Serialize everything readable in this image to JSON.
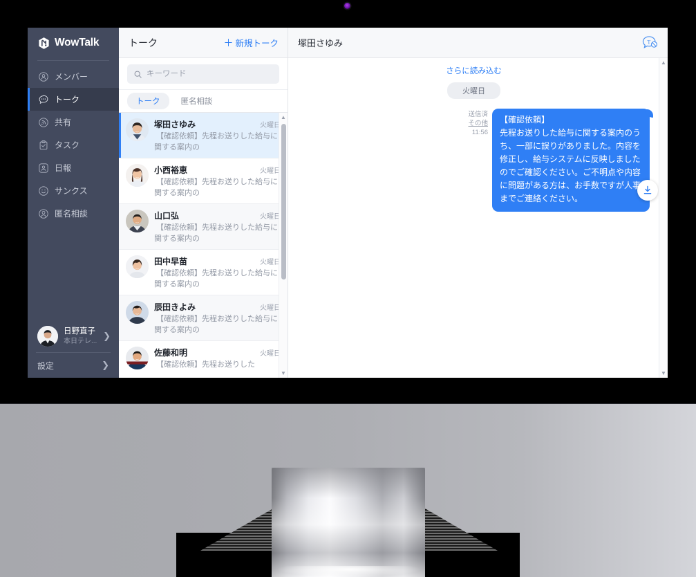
{
  "app": {
    "brand": "WowTalk",
    "logo_icon": "wowtalk-hex-logo"
  },
  "colors": {
    "sidebar_bg": "#434a5e",
    "sidebar_active_bg": "#363c4d",
    "accent": "#2f7ff5",
    "selected_row_bg": "#e3f0fd",
    "panel_header_bg": "#f7f8fa"
  },
  "sidebar": {
    "items": [
      {
        "label": "メンバー",
        "icon": "member-circle-icon",
        "active": false
      },
      {
        "label": "トーク",
        "icon": "talk-bubble-icon",
        "active": true
      },
      {
        "label": "共有",
        "icon": "share-broadcast-icon",
        "active": false
      },
      {
        "label": "タスク",
        "icon": "task-clipboard-icon",
        "active": false
      },
      {
        "label": "日報",
        "icon": "report-person-icon",
        "active": false
      },
      {
        "label": "サンクス",
        "icon": "thanks-smiley-icon",
        "active": false
      },
      {
        "label": "匿名相談",
        "icon": "anonymous-person-icon",
        "active": false
      }
    ],
    "profile": {
      "name": "日野直子",
      "status": "本日テレ...",
      "chevron_icon": "chevron-right-icon",
      "avatar_name": "profile-avatar"
    },
    "settings": {
      "label": "設定",
      "chevron_icon": "chevron-right-icon"
    }
  },
  "talk_list": {
    "header": {
      "title": "トーク",
      "new_talk_label": "新規トーク",
      "new_talk_icon": "plus-icon"
    },
    "search": {
      "placeholder": "キーワード",
      "value": "",
      "icon": "search-icon"
    },
    "tabs": [
      {
        "label": "トーク",
        "active": true
      },
      {
        "label": "匿名相談",
        "active": false
      }
    ],
    "items": [
      {
        "name": "塚田さゆみ",
        "time": "火曜日",
        "preview": "【確認依頼】先程お送りした給与に関する案内の",
        "selected": true
      },
      {
        "name": "小西裕恵",
        "time": "火曜日",
        "preview": "【確認依頼】先程お送りした給与に関する案内の",
        "selected": false
      },
      {
        "name": "山口弘",
        "time": "火曜日",
        "preview": "【確認依頼】先程お送りした給与に関する案内の",
        "selected": false
      },
      {
        "name": "田中早苗",
        "time": "火曜日",
        "preview": "【確認依頼】先程お送りした給与に関する案内の",
        "selected": false
      },
      {
        "name": "辰田きよみ",
        "time": "火曜日",
        "preview": "【確認依頼】先程お送りした給与に関する案内の",
        "selected": false
      },
      {
        "name": "佐藤和明",
        "time": "火曜日",
        "preview": "【確認依頼】先程お送りした",
        "selected": false
      }
    ],
    "scrollbar": {
      "up_arrow": "▲",
      "down_arrow": "▼"
    }
  },
  "chat": {
    "header": {
      "title": "塚田さゆみ",
      "action_icon": "translate-bubble-icon"
    },
    "load_more": "さらに読み込む",
    "date_divider": "火曜日",
    "message": {
      "status": "送信済",
      "more_label": "その他",
      "time": "11:56",
      "text": "【確認依頼】\n先程お送りした給与に関する案内のうち、一部に誤りがありました。内容を修正し、給与システムに反映しましたのでご確認ください。ご不明点や内容に問題がある方は、お手数ですが人事までご連絡ください。"
    },
    "scroll_to_bottom_icon": "download-arrow-icon",
    "scrollbar": {
      "up_arrow": "▲",
      "down_arrow": "▼"
    }
  },
  "device": {
    "webcam_icon": "webcam-dot",
    "stand_name": "monitor-stand"
  }
}
